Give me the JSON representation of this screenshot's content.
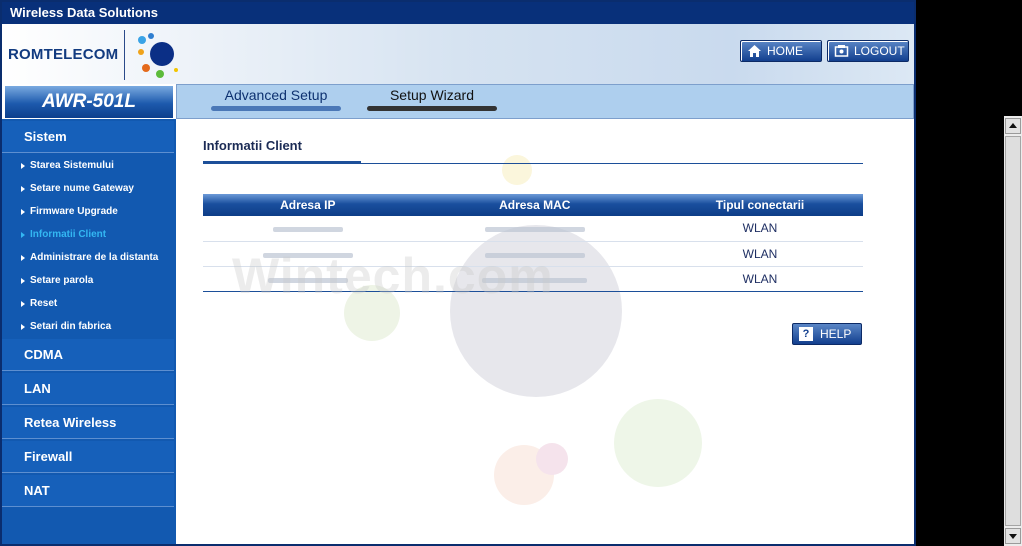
{
  "window": {
    "title": "Wireless Data Solutions"
  },
  "header": {
    "brand": "ROMTELECOM",
    "home_label": "HOME",
    "logout_label": "LOGOUT"
  },
  "model": "AWR-501L",
  "tabs": [
    {
      "label": "Advanced Setup",
      "selected": true
    },
    {
      "label": "Setup Wizard",
      "selected": false
    }
  ],
  "sidebar": {
    "sections": [
      {
        "label": "Sistem"
      },
      {
        "label": "CDMA"
      },
      {
        "label": "LAN"
      },
      {
        "label": "Retea Wireless"
      },
      {
        "label": "Firewall"
      },
      {
        "label": "NAT"
      }
    ],
    "sistem_items": [
      {
        "label": "Starea Sistemului"
      },
      {
        "label": "Setare nume Gateway"
      },
      {
        "label": "Firmware Upgrade"
      },
      {
        "label": "Informatii Client",
        "active": true
      },
      {
        "label": "Administrare de la distanta"
      },
      {
        "label": "Setare parola"
      },
      {
        "label": "Reset"
      },
      {
        "label": "Setari din fabrica"
      }
    ]
  },
  "main": {
    "title": "Informatii Client",
    "table": {
      "headers": [
        "Adresa IP",
        "Adresa MAC",
        "Tipul conectarii"
      ],
      "rows": [
        {
          "ip": "",
          "mac": "",
          "type": "WLAN"
        },
        {
          "ip": "",
          "mac": "",
          "type": "WLAN"
        },
        {
          "ip": "",
          "mac": "",
          "type": "WLAN"
        }
      ]
    },
    "help_label": "HELP",
    "watermark": "Wintech.com"
  },
  "colors": {
    "title_bar": "#08307a",
    "sidebar": "#1259b0",
    "active_link": "#33b7f2",
    "tab_bar": "#aecfee"
  },
  "icons": [
    "home-icon",
    "logout-icon",
    "help-icon",
    "arrow-right-icon",
    "scroll-up-icon",
    "scroll-down-icon"
  ]
}
